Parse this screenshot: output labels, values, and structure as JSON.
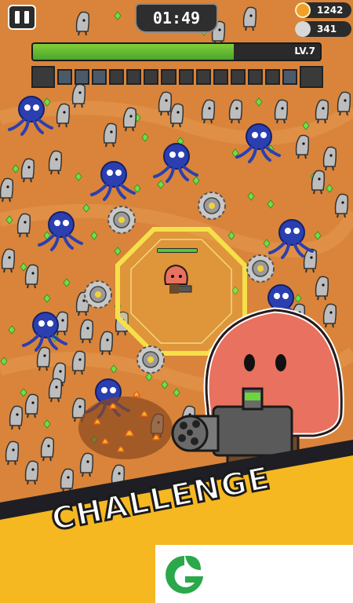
{
  "hud": {
    "timer": "01:49",
    "coins": "1242",
    "kills": "341",
    "level": "LV.7",
    "xp_fraction": 0.7,
    "weapon_slots": 14
  },
  "banner": {
    "text": "CHALLENGE"
  },
  "icons": [
    "pause-icon",
    "coin-icon",
    "skull-icon",
    "sawblade-icon",
    "minigun-icon",
    "leaf-logo-icon"
  ],
  "colors": {
    "ground": "#d9843a",
    "xp": "#5fbf33",
    "aura": "#f6d23a",
    "player": "#e8715f"
  }
}
